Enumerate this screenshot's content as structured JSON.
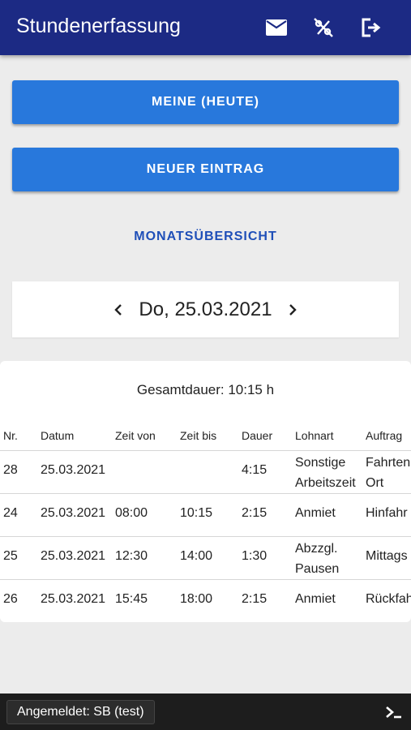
{
  "appbar": {
    "title": "Stundenerfassung",
    "icons": [
      "mail-icon",
      "percent-off-icon",
      "logout-icon"
    ]
  },
  "buttons": {
    "today": "MEINE (HEUTE)",
    "new_entry": "NEUER EINTRAG",
    "month_overview": "MONATSÜBERSICHT"
  },
  "date_nav": {
    "date": "Do, 25.03.2021",
    "prev_icon": "chevron-left-icon",
    "next_icon": "chevron-right-icon"
  },
  "table": {
    "total": "Gesamtdauer: 10:15 h",
    "headers": {
      "nr": "Nr.",
      "datum": "Datum",
      "von": "Zeit von",
      "bis": "Zeit bis",
      "dauer": "Dauer",
      "lohnart": "Lohnart",
      "auftrag": "Auftrag"
    },
    "rows": [
      {
        "nr": "28",
        "datum": "25.03.2021",
        "von": "",
        "bis": "",
        "dauer": "4:15",
        "lohnart_1": "Sonstige",
        "lohnart_2": "Arbeitszeit",
        "auftrag_1": "Fahrten",
        "auftrag_2": "Ort"
      },
      {
        "nr": "24",
        "datum": "25.03.2021",
        "von": "08:00",
        "bis": "10:15",
        "dauer": "2:15",
        "lohnart_1": "Anmiet",
        "lohnart_2": "",
        "auftrag_1": "Hinfahr",
        "auftrag_2": ""
      },
      {
        "nr": "25",
        "datum": "25.03.2021",
        "von": "12:30",
        "bis": "14:00",
        "dauer": "1:30",
        "lohnart_1": "Abzzgl.",
        "lohnart_2": "Pausen",
        "auftrag_1": "Mittags",
        "auftrag_2": ""
      },
      {
        "nr": "26",
        "datum": "25.03.2021",
        "von": "15:45",
        "bis": "18:00",
        "dauer": "2:15",
        "lohnart_1": "Anmiet",
        "lohnart_2": "",
        "auftrag_1": "Rückfah",
        "auftrag_2": ""
      }
    ]
  },
  "status": {
    "logged_in": "Angemeldet: SB (test)",
    "terminal_icon": "terminal-icon"
  },
  "colors": {
    "appbar": "#1c2a84",
    "primary_button": "#2878dc",
    "link": "#1f4fb8",
    "bottombar": "#1d1d1d"
  }
}
